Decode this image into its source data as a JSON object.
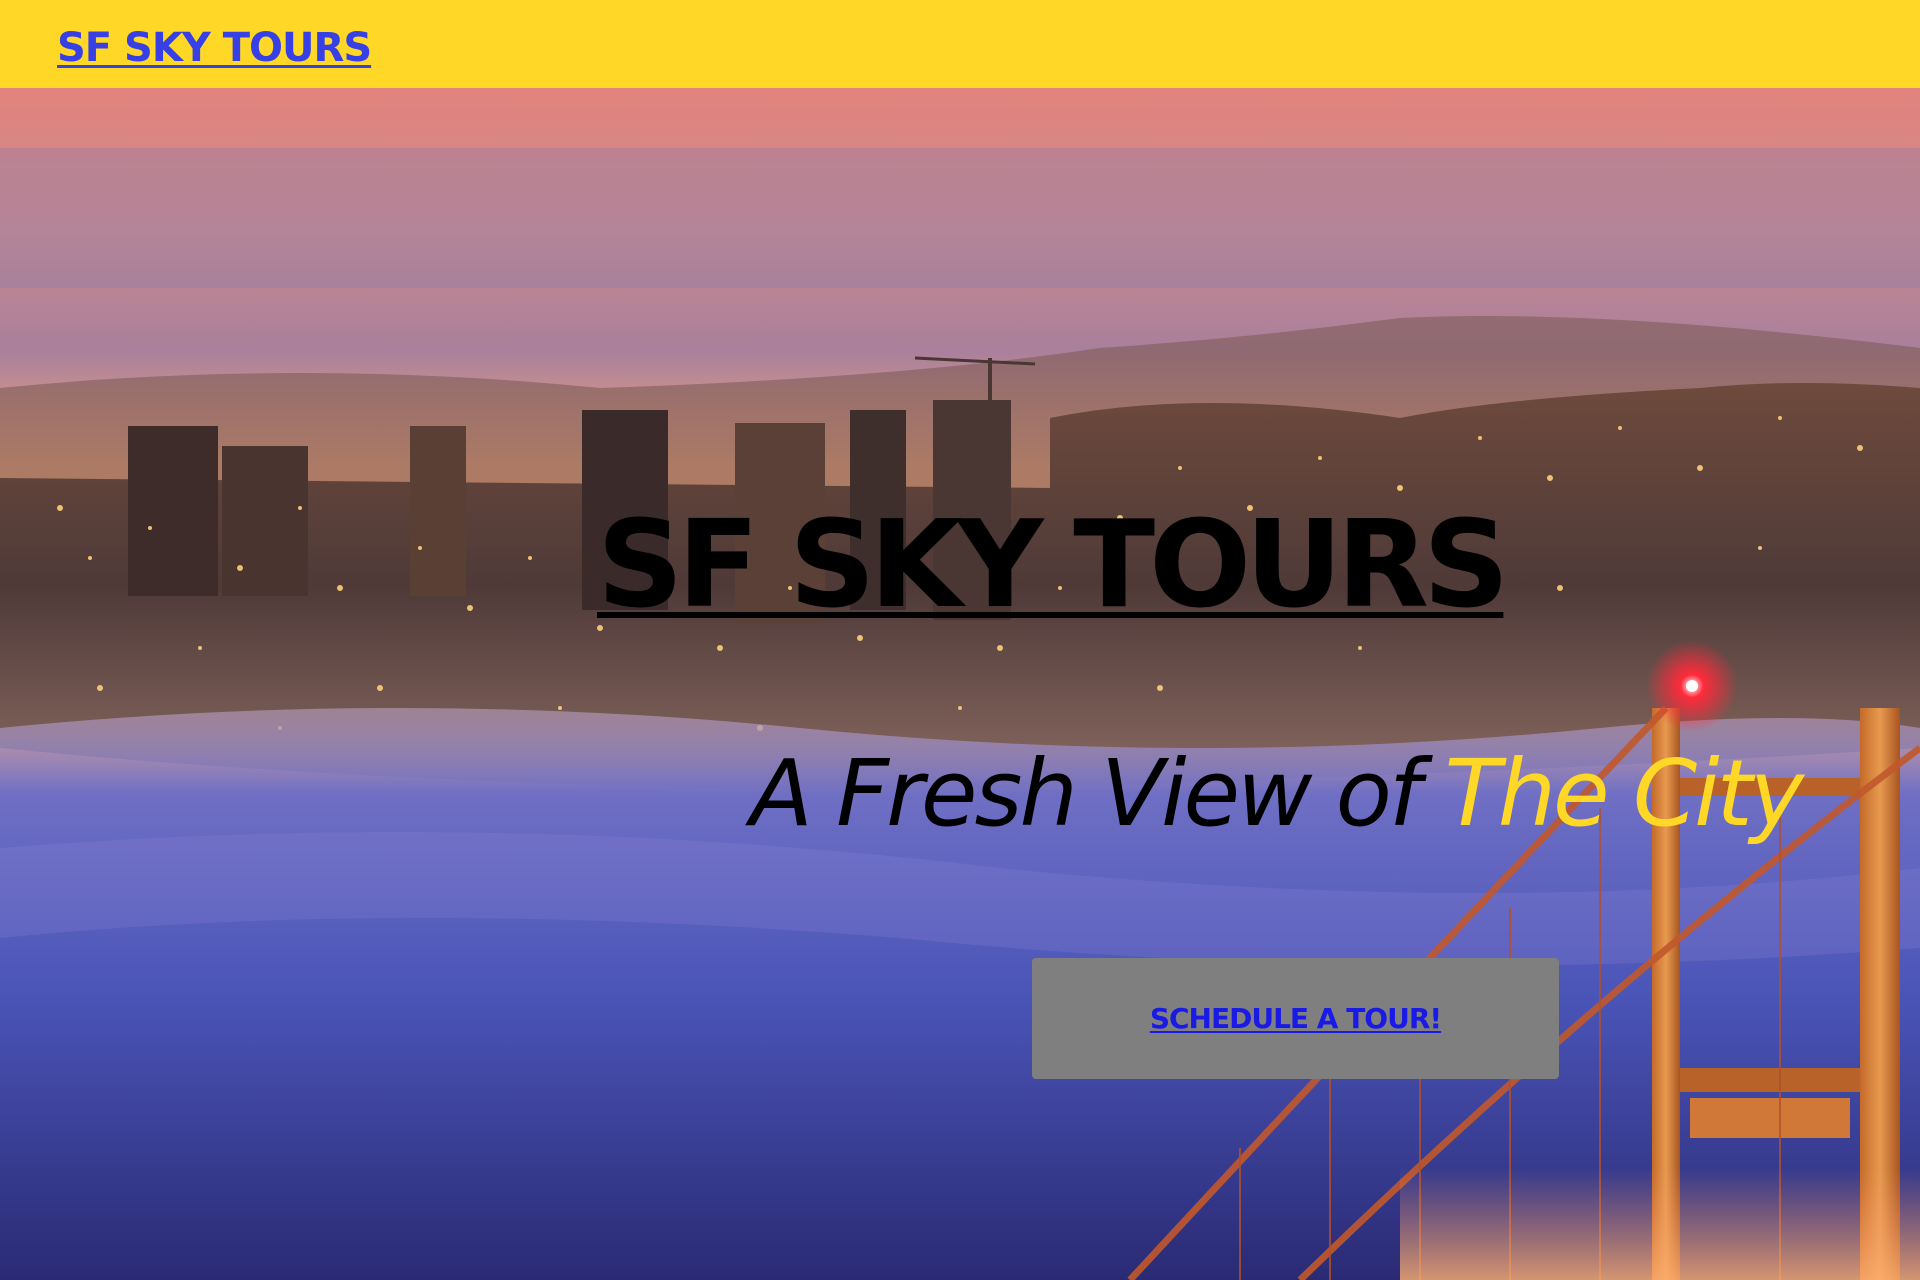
{
  "header": {
    "brand_link": "SF SKY TOURS"
  },
  "hero": {
    "title": "SF SKY TOURS",
    "subtitle_prefix": "A Fresh View of ",
    "subtitle_accent": "The City",
    "cta_label": "SCHEDULE A TOUR!"
  },
  "colors": {
    "brand_yellow": "#ffd726",
    "link_blue": "#3740e4",
    "button_gray": "#7f7f7f",
    "button_text_blue": "#1a1ae6"
  }
}
